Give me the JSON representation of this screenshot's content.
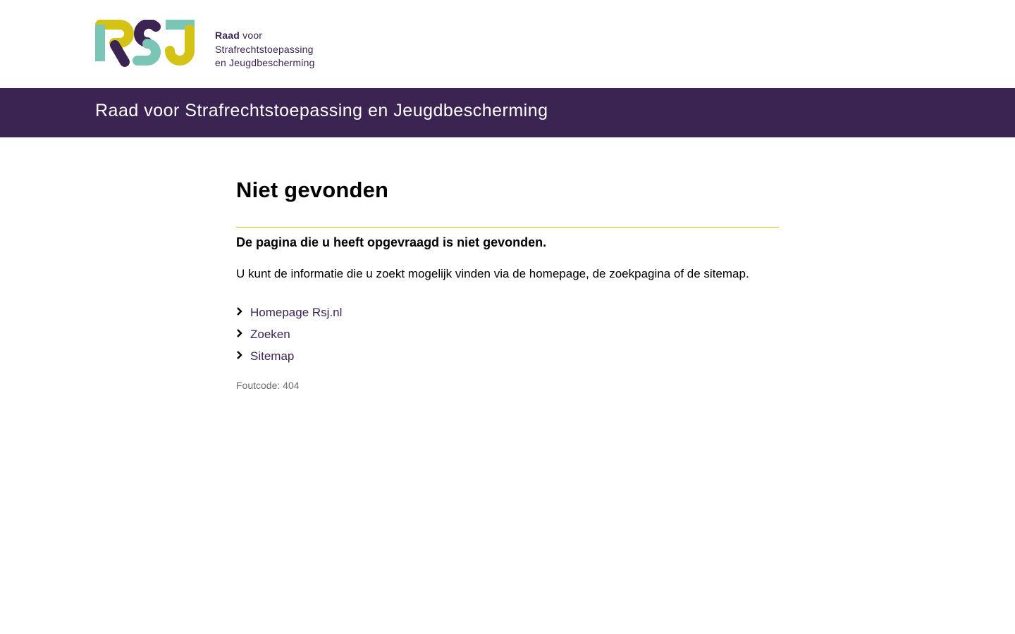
{
  "logo": {
    "mark_letters": "RSJ",
    "line1_strong": "Raad",
    "line1_rest": " voor",
    "line2": "Strafrechtstoepassing",
    "line3": "en Jeugdbescherming",
    "colors": {
      "yellow": "#d4c314",
      "purple": "#3b2352",
      "teal": "#7ac5b5"
    }
  },
  "banner": {
    "title": "Raad voor Strafrechtstoepassing en Jeugdbescherming",
    "background": "#3b2352"
  },
  "main": {
    "title": "Niet gevonden",
    "lead": "De pagina die u heeft opgevraagd is niet gevonden.",
    "body": "U kunt de informatie die u zoekt mogelijk vinden via de homepage, de zoekpagina of de sitemap.",
    "links": [
      {
        "label": "Homepage Rsj.nl",
        "icon": "chevron-right-icon"
      },
      {
        "label": "Zoeken",
        "icon": "chevron-right-icon"
      },
      {
        "label": "Sitemap",
        "icon": "chevron-right-icon"
      }
    ],
    "error_code": "Foutcode: 404",
    "divider_color": "#d3c30e"
  }
}
